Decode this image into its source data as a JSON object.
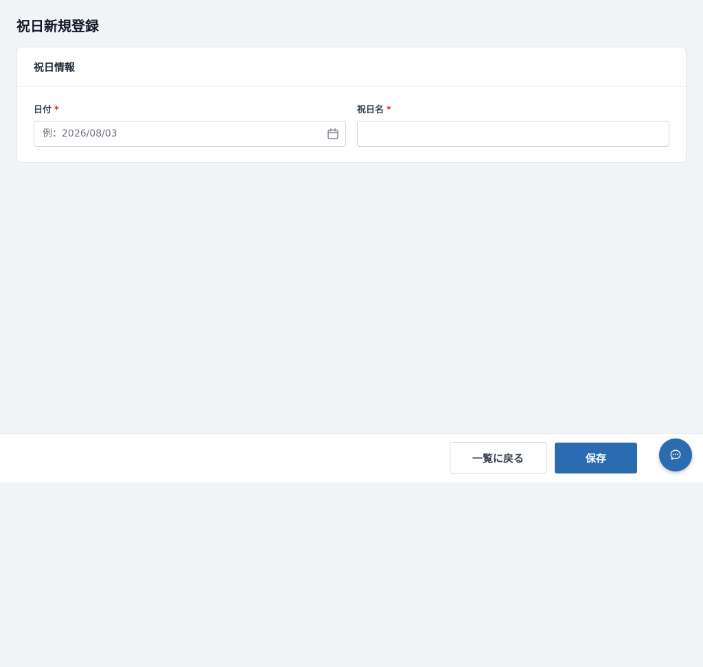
{
  "page": {
    "title": "祝日新規登録"
  },
  "card": {
    "title": "祝日情報",
    "fields": {
      "date": {
        "label": "日付",
        "required_mark": "*",
        "value": "",
        "placeholder": "例：2026/08/03",
        "icon": "calendar-icon"
      },
      "name": {
        "label": "祝日名",
        "required_mark": "*",
        "value": "",
        "placeholder": ""
      }
    }
  },
  "footer": {
    "back_label": "一覧に戻る",
    "save_label": "保存"
  },
  "chat": {
    "icon": "chat-bubble-icon"
  },
  "colors": {
    "primary": "#2b6cb0",
    "required": "#dc2626",
    "background": "#f2f4f7"
  }
}
